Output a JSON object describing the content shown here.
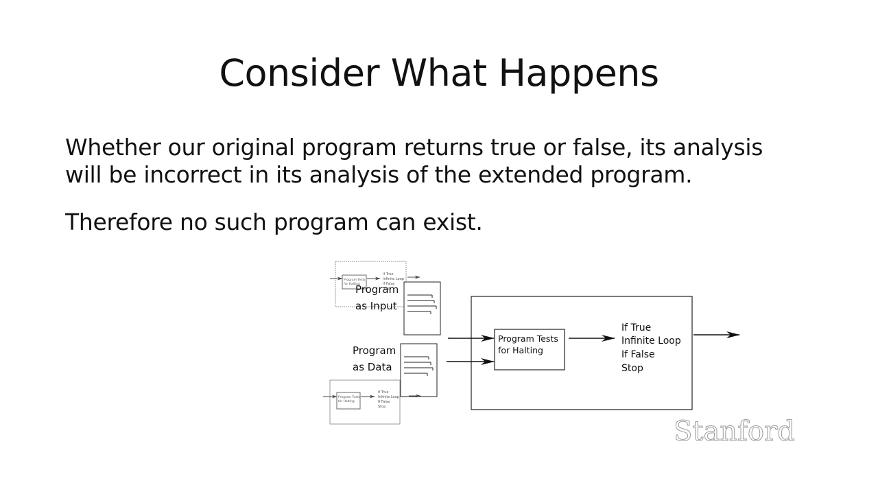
{
  "slide": {
    "title": "Consider What Happens",
    "paragraph_1_line_1": "Whether our original program returns true or false, its analysis",
    "paragraph_1_line_2": "will be incorrect in its analysis of the extended program.",
    "paragraph_2": "Therefore no such program can exist."
  },
  "diagram": {
    "input_label_line_1": "Program",
    "input_label_line_2": "as Input",
    "data_label_line_1": "Program",
    "data_label_line_2": "as Data",
    "tester_line_1": "Program Tests",
    "tester_line_2": "for Halting",
    "outcome_line_1": "If True",
    "outcome_line_2": "Infinite Loop",
    "outcome_line_3": "If False",
    "outcome_line_4": "Stop",
    "mini_tester_line_1": "Program Tests",
    "mini_tester_line_2": "for Halting",
    "mini_outcome_line_1": "If True",
    "mini_outcome_line_2": "Infinite Loop",
    "mini_outcome_line_3": "If False",
    "mini_outcome_line_4": "Stop"
  },
  "branding": {
    "logo_text": "Stanford"
  }
}
